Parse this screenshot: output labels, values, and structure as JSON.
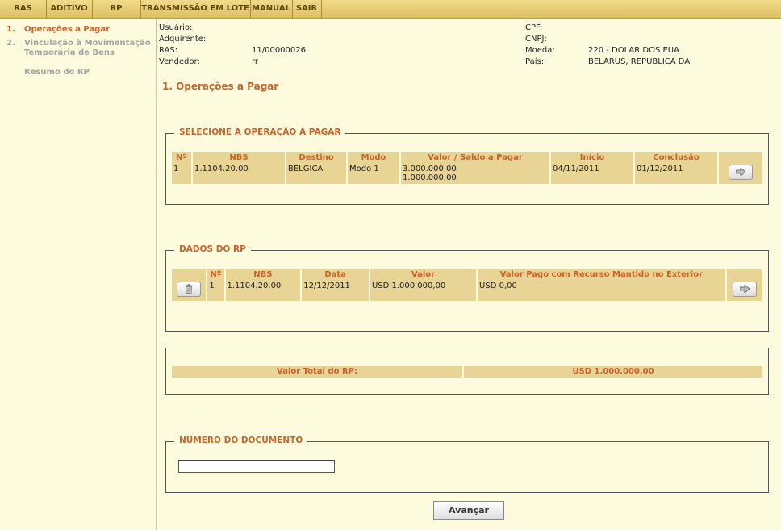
{
  "menu": [
    "RAS",
    "ADITIVO",
    "RP",
    "TRANSMISSÃO EM LOTE",
    "MANUAL",
    "SAIR"
  ],
  "sidebar": {
    "steps": [
      {
        "num": "1.",
        "label": "Operações a Pagar"
      },
      {
        "num": "2.",
        "label": "Vinculação à Movimentação Temporária de Bens"
      },
      {
        "num": "",
        "label": "Resumo do RP"
      }
    ]
  },
  "header": {
    "usuario_label": "Usuário:",
    "adquirente_label": "Adquirente:",
    "ras_label": "RAS:",
    "ras_value": "11/00000026",
    "vendedor_label": "Vendedor:",
    "vendedor_value": "rr",
    "cpf_label": "CPF:",
    "cnpj_label": "CNPJ:",
    "moeda_label": "Moeda:",
    "moeda_value": "220 - DOLAR DOS EUA",
    "pais_label": "País:",
    "pais_value": "BELARUS, REPUBLICA DA"
  },
  "page_title": "1. Operações a Pagar",
  "operations": {
    "legend": "SELECIONE A OPERAÇÃO A PAGAR",
    "columns": [
      "Nº",
      "NBS",
      "Destino",
      "Modo",
      "Valor / Saldo a Pagar",
      "Início",
      "Conclusão"
    ],
    "row": {
      "num": "1",
      "nbs": "1.1104.20.00",
      "destino": "BELGICA",
      "modo": "Modo 1",
      "valor": "3.000.000,00",
      "saldo": "1.000.000,00",
      "inicio": "04/11/2011",
      "conclusao": "01/12/2011"
    }
  },
  "rp": {
    "legend": "DADOS DO RP",
    "columns": [
      "Nº",
      "NBS",
      "Data",
      "Valor",
      "Valor Pago com Recurso Mantido no Exterior"
    ],
    "row": {
      "num": "1",
      "nbs": "1.1104.20.00",
      "data": "12/12/2011",
      "valor": "USD  1.000.000,00",
      "valor_pago": "USD  0,00"
    }
  },
  "total": {
    "label": "Valor Total do RP:",
    "value": "USD  1.000.000,00"
  },
  "document": {
    "legend": "NÚMERO DO DOCUMENTO",
    "value": ""
  },
  "advance_label": "Avançar"
}
